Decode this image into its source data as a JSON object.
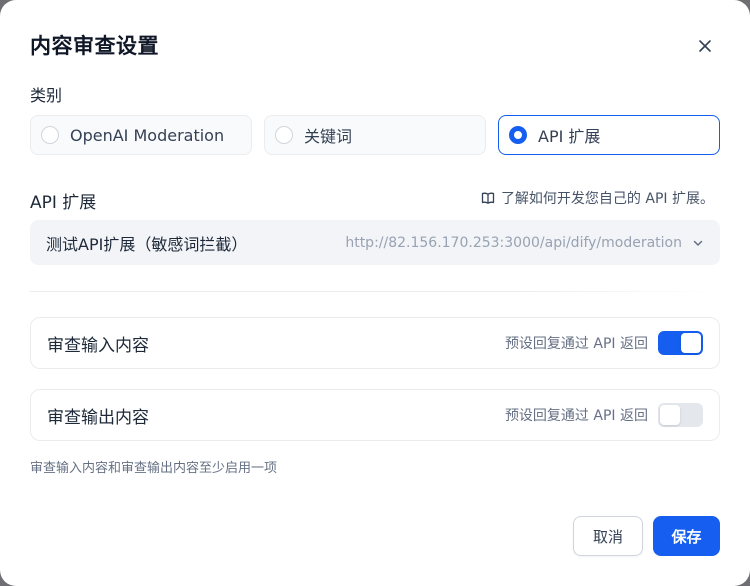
{
  "dialog": {
    "title": "内容审查设置",
    "close_icon": "close-icon"
  },
  "category": {
    "label": "类别",
    "options": [
      {
        "label": "OpenAI Moderation",
        "selected": false
      },
      {
        "label": "关键词",
        "selected": false
      },
      {
        "label": "API 扩展",
        "selected": true
      }
    ]
  },
  "api_extension": {
    "label": "API 扩展",
    "doc_link": "了解如何开发您自己的 API 扩展。",
    "doc_icon": "book-icon",
    "selected_name": "测试API扩展（敏感词拦截）",
    "selected_url": "http://82.156.170.253:3000/api/dify/moderation",
    "chevron_icon": "chevron-down-icon"
  },
  "review_input": {
    "title": "审查输入内容",
    "hint": "预设回复通过 API 返回",
    "enabled": true
  },
  "review_output": {
    "title": "审查输出内容",
    "hint": "预设回复通过 API 返回",
    "enabled": false
  },
  "footnote": "审查输入内容和审查输出内容至少启用一项",
  "footer": {
    "cancel_label": "取消",
    "save_label": "保存"
  },
  "colors": {
    "primary": "#155eef",
    "toggle_off": "#e4e7ec"
  }
}
